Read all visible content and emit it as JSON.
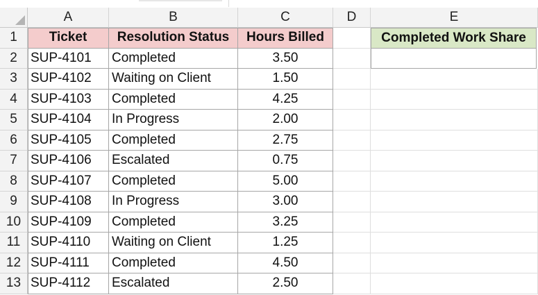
{
  "columns": [
    "A",
    "B",
    "C",
    "D",
    "E"
  ],
  "rows": [
    "1",
    "2",
    "3",
    "4",
    "5",
    "6",
    "7",
    "8",
    "9",
    "10",
    "11",
    "12",
    "13"
  ],
  "table": {
    "headers": {
      "ticket": "Ticket",
      "status": "Resolution Status",
      "hours": "Hours Billed"
    },
    "data": [
      {
        "ticket": "SUP-4101",
        "status": "Completed",
        "hours": "3.50"
      },
      {
        "ticket": "SUP-4102",
        "status": "Waiting on Client",
        "hours": "1.50"
      },
      {
        "ticket": "SUP-4103",
        "status": "Completed",
        "hours": "4.25"
      },
      {
        "ticket": "SUP-4104",
        "status": "In Progress",
        "hours": "2.00"
      },
      {
        "ticket": "SUP-4105",
        "status": "Completed",
        "hours": "2.75"
      },
      {
        "ticket": "SUP-4106",
        "status": "Escalated",
        "hours": "0.75"
      },
      {
        "ticket": "SUP-4107",
        "status": "Completed",
        "hours": "5.00"
      },
      {
        "ticket": "SUP-4108",
        "status": "In Progress",
        "hours": "3.00"
      },
      {
        "ticket": "SUP-4109",
        "status": "Completed",
        "hours": "3.25"
      },
      {
        "ticket": "SUP-4110",
        "status": "Waiting on Client",
        "hours": "1.25"
      },
      {
        "ticket": "SUP-4111",
        "status": "Completed",
        "hours": "4.50"
      },
      {
        "ticket": "SUP-4112",
        "status": "Escalated",
        "hours": "2.50"
      }
    ]
  },
  "summary": {
    "label": "Completed Work Share",
    "value": ""
  },
  "colors": {
    "header_pink": "#f4cccc",
    "header_green": "#d9e8c6",
    "headers_bg": "#f3f3f3"
  }
}
